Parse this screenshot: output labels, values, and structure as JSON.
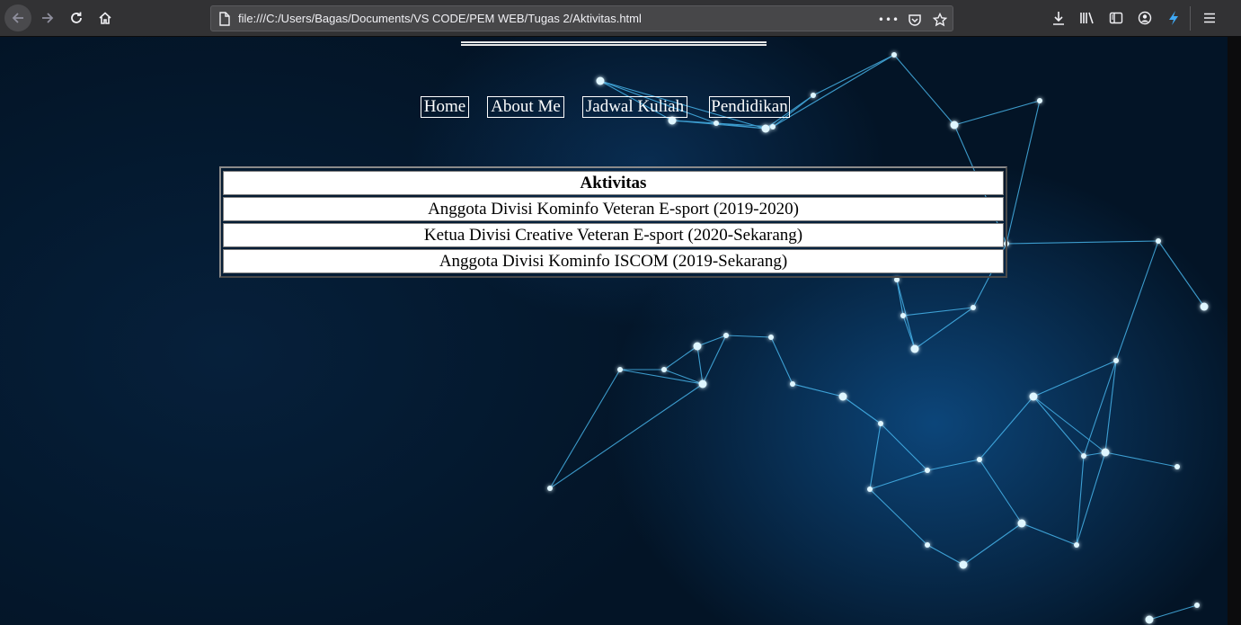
{
  "browser": {
    "url": "file:///C:/Users/Bagas/Documents/VS CODE/PEM WEB/Tugas 2/Aktivitas.html",
    "more_glyph": "•••"
  },
  "nav": {
    "items": [
      {
        "label": "Home"
      },
      {
        "label": "About Me"
      },
      {
        "label": "Jadwal Kuliah"
      },
      {
        "label": "Pendidikan"
      }
    ]
  },
  "table": {
    "header": "Aktivitas",
    "rows": [
      "Anggota Divisi Kominfo Veteran E-sport (2019-2020)",
      "Ketua Divisi Creative Veteran E-sport (2020-Sekarang)",
      "Anggota Divisi Kominfo ISCOM (2019-Sekarang)"
    ]
  },
  "colors": {
    "chrome": "#323234",
    "urlbar": "#474749",
    "page_background": "#041a30",
    "network_glow": "#5fd4ff"
  }
}
